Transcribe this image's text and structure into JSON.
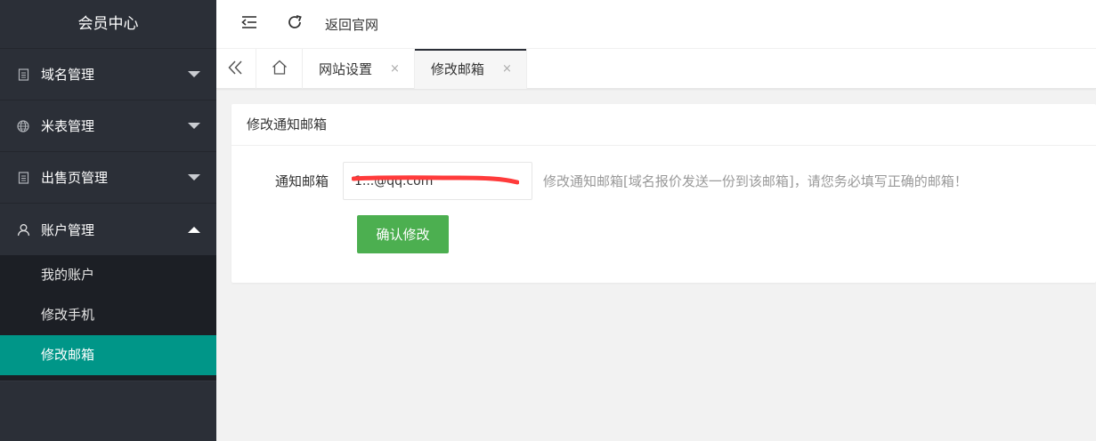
{
  "sidebar": {
    "title": "会员中心",
    "items": [
      {
        "label": "域名管理",
        "icon": "document-icon",
        "expanded": false
      },
      {
        "label": "米表管理",
        "icon": "globe-icon",
        "expanded": false
      },
      {
        "label": "出售页管理",
        "icon": "document-icon",
        "expanded": false
      },
      {
        "label": "账户管理",
        "icon": "user-icon",
        "expanded": true
      }
    ],
    "submenu": [
      {
        "label": "我的账户",
        "active": false
      },
      {
        "label": "修改手机",
        "active": false
      },
      {
        "label": "修改邮箱",
        "active": true
      }
    ]
  },
  "header": {
    "back_label": "返回官网"
  },
  "tabs": [
    {
      "label": "网站设置",
      "close": "×",
      "active": false
    },
    {
      "label": "修改邮箱",
      "close": "×",
      "active": true
    }
  ],
  "card": {
    "title": "修改通知邮箱",
    "field_label": "通知邮箱",
    "field_value": "1...@qq.com",
    "hint": "修改通知邮箱[域名报价发送一份到该邮箱]，请您务必填写正确的邮箱！",
    "submit_label": "确认修改"
  },
  "colors": {
    "sidebar_bg": "#2b2f37",
    "submenu_bg": "#1c1f25",
    "active_teal": "#009688",
    "button_green": "#4caf50",
    "redaction_red": "#ff3b3b"
  }
}
